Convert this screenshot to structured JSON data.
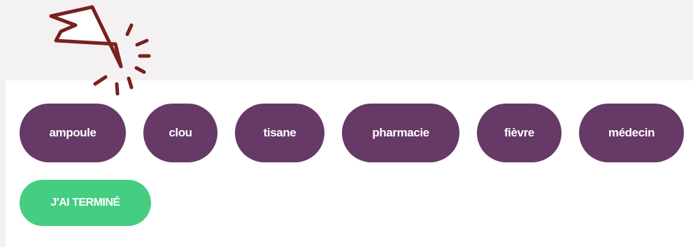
{
  "words": [
    "ampoule",
    "clou",
    "tisane",
    "pharmacie",
    "fièvre",
    "médecin"
  ],
  "done_button": {
    "label": "J'AI TERMINÉ"
  },
  "colors": {
    "background": "#f4f1f2",
    "panel": "#ffffff",
    "chip": "#673967",
    "done": "#45cd82",
    "pointer": "#7a1f1f"
  },
  "icons": {
    "pointer": "cursor-click-icon"
  }
}
